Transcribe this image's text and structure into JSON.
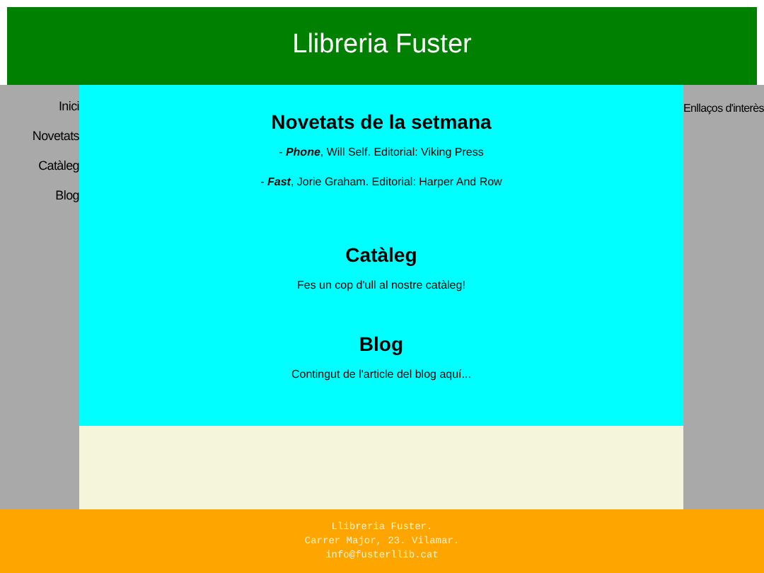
{
  "header": {
    "title": "Llibreria Fuster"
  },
  "nav": {
    "items": [
      {
        "label": "Inici"
      },
      {
        "label": "Novetats"
      },
      {
        "label": "Catàleg"
      },
      {
        "label": "Blog"
      }
    ]
  },
  "sections": [
    {
      "kind": "books",
      "heading": "Novetats de la setmana",
      "books": [
        {
          "marker": "- ",
          "title": "Phone",
          "rest": ", Will Self. Editorial: Viking Press"
        },
        {
          "marker": "- ",
          "title": "Fast",
          "rest": ", Jorie Graham. Editorial: Harper And Row"
        }
      ]
    },
    {
      "kind": "text",
      "heading": "Catàleg",
      "text": "Fes un cop d'ull al nostre catàleg!"
    },
    {
      "kind": "text",
      "heading": "Blog",
      "text": "Contingut de l'article del blog aquí..."
    }
  ],
  "aside": {
    "title": "Enllaços d'interès"
  },
  "footer": {
    "lines": [
      "Llibreria Fuster.",
      "Carrer Major, 23. Vilamar.",
      "info@fusterllib.cat"
    ]
  }
}
